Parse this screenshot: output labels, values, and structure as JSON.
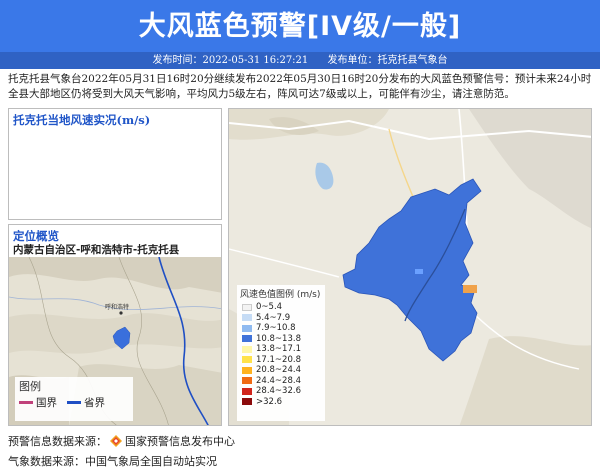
{
  "header": {
    "title": "大风蓝色预警[IV级/一般]",
    "publish_time_label": "发布时间：2022-05-31 16:27:21",
    "publisher_label": "发布单位：托克托县气象台",
    "bg_color": "#3a78e8"
  },
  "description": "托克托县气象台2022年05月31日16时20分继续发布2022年05月30日16时20分发布的大风蓝色预警信号：预计未来24小时全县大部地区仍将受到大风天气影响，平均风力5级左右，阵风可达7级或以上，可能伴有沙尘，请注意防范。",
  "wind_panel": {
    "title": "托克托当地风速实况(m/s)"
  },
  "location_panel": {
    "title": "定位概览",
    "path": "内蒙古自治区-呼和浩特市-托克托县",
    "map_labels": [
      "呼和浩特"
    ],
    "legend": {
      "title": "图例",
      "items": [
        {
          "label": "国界",
          "color": "#c0417a"
        },
        {
          "label": "省界",
          "color": "#1f4fc4"
        }
      ]
    }
  },
  "wind_legend": {
    "title": "风速色值图例 (m/s)",
    "items": [
      {
        "label": "0~5.4",
        "color": "#f3f3f3"
      },
      {
        "label": "5.4~7.9",
        "color": "#c6dcf5"
      },
      {
        "label": "7.9~10.8",
        "color": "#8fbaf0"
      },
      {
        "label": "10.8~13.8",
        "color": "#3f72d9"
      },
      {
        "label": "13.8~17.1",
        "color": "#fff7a8"
      },
      {
        "label": "17.1~20.8",
        "color": "#ffe24a"
      },
      {
        "label": "20.8~24.4",
        "color": "#ffb21f"
      },
      {
        "label": "24.4~28.4",
        "color": "#f06a13"
      },
      {
        "label": "28.4~32.6",
        "color": "#d0241b"
      },
      {
        "label": ">32.6",
        "color": "#8b0a0a"
      }
    ]
  },
  "footer": {
    "warning_source_label": "预警信息数据来源：",
    "warning_source_value": "国家预警信息发布中心",
    "weather_source": "气象数据来源：中国气象局全国自动站实况"
  }
}
